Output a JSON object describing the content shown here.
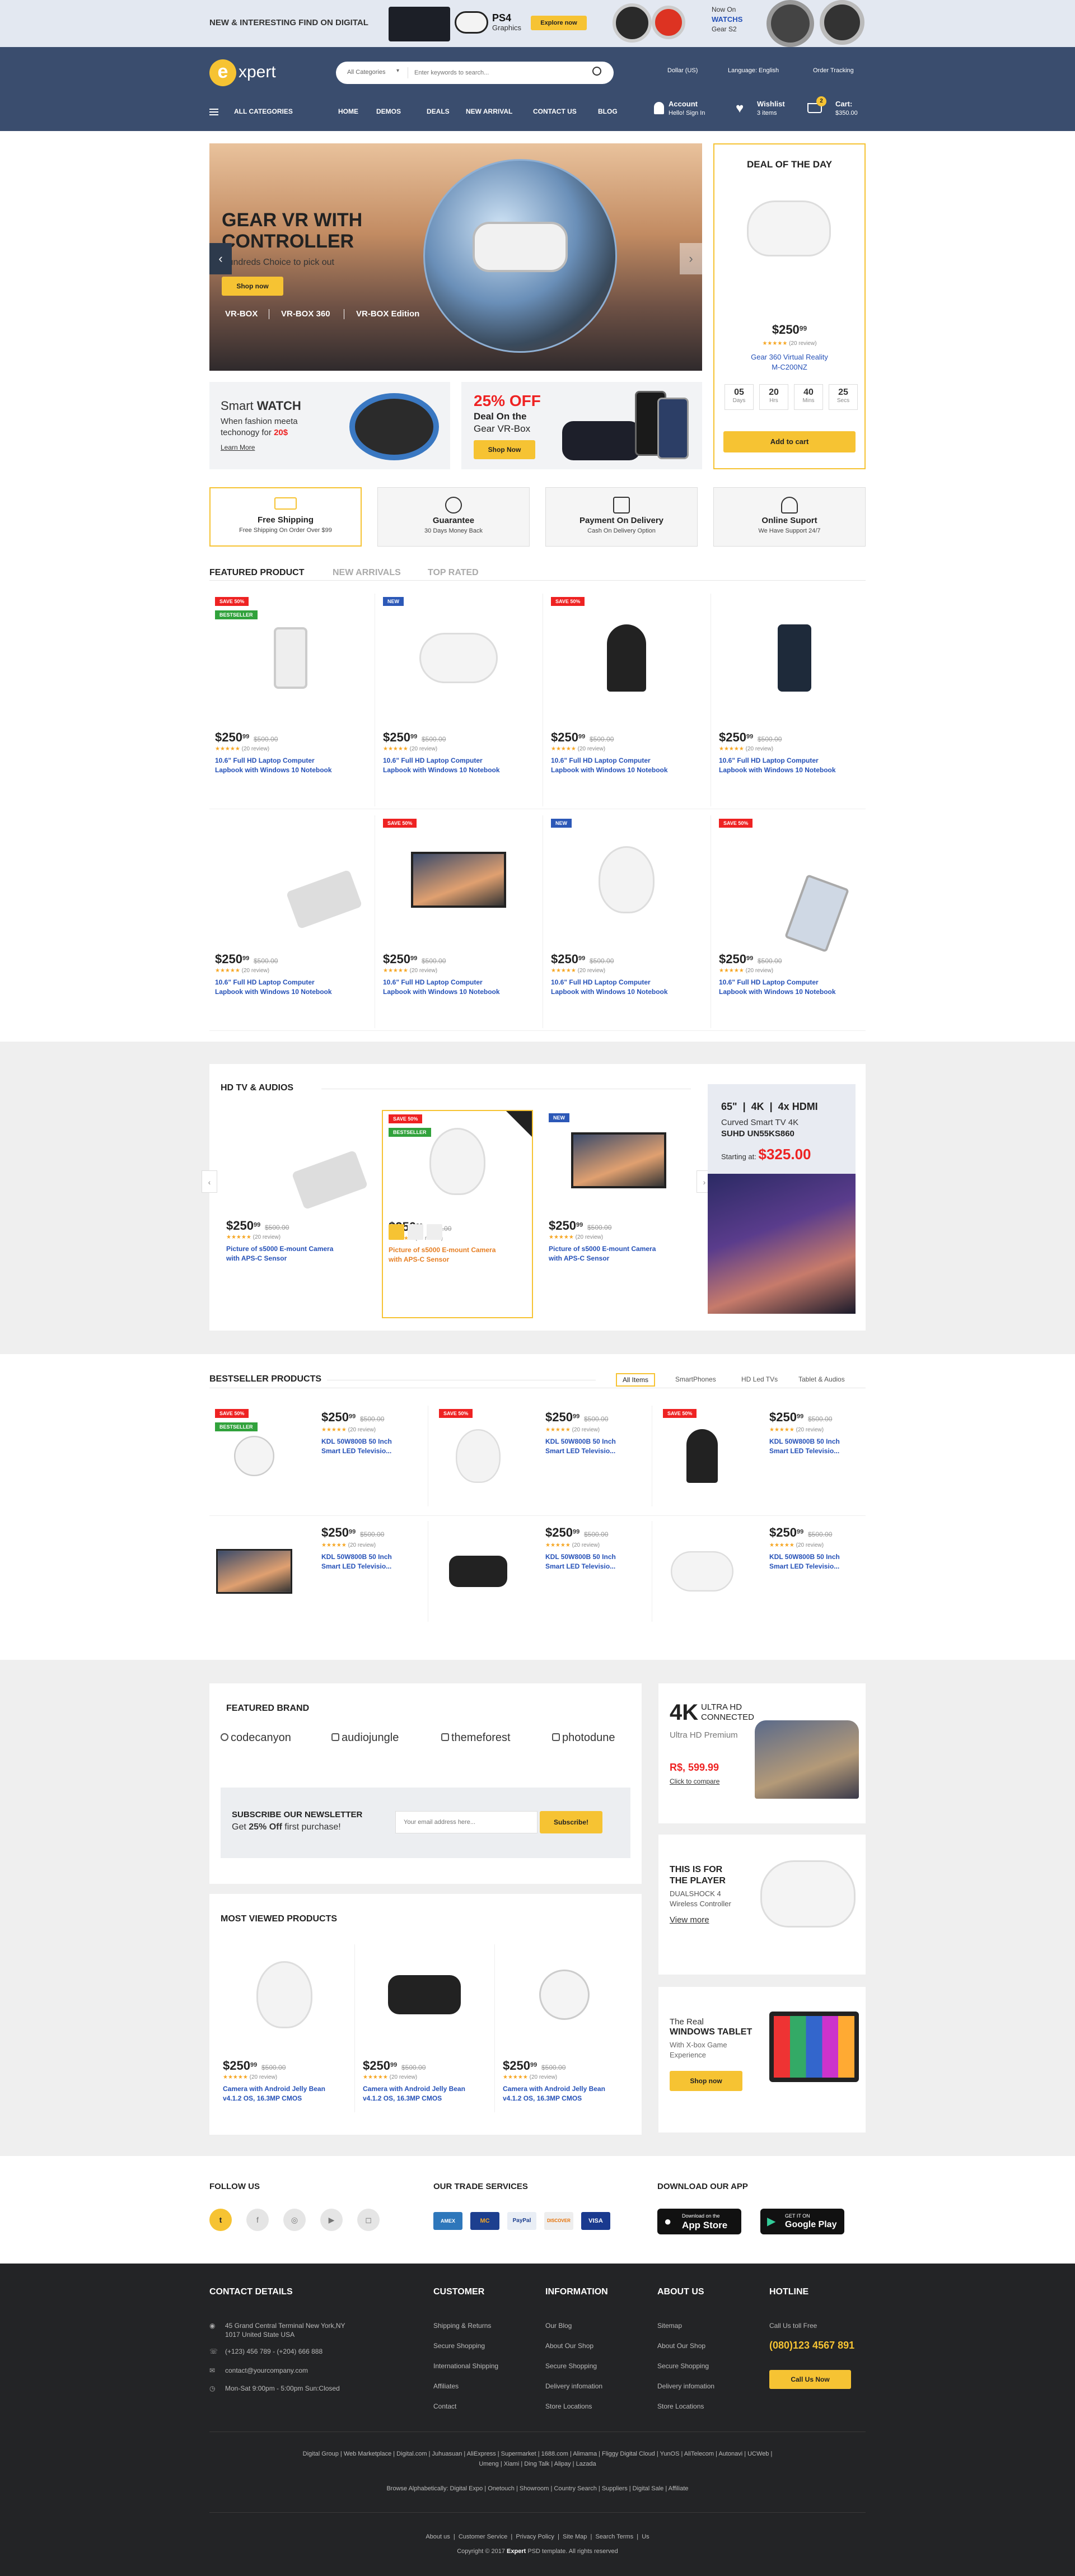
{
  "topbanner": {
    "tagline": "NEW & INTERESTING FIND ON DIGITAL",
    "ps4": "PS4",
    "ps4_sub": "Graphics",
    "explore": "Explore now",
    "nowon": "Now On",
    "watchs": "WATCHS",
    "gear": "Gear S2"
  },
  "header": {
    "logo_e": "e",
    "logo_rest": "xpert",
    "category": "All Categories",
    "search_placeholder": "Enter keywords to search...",
    "currency": "Dollar (US)",
    "language": "Language: English",
    "order": "Order Tracking",
    "nav": [
      "ALL CATEGORIES",
      "HOME",
      "DEMOS",
      "DEALS",
      "NEW ARRIVAL",
      "CONTACT US",
      "BLOG"
    ],
    "account": "Account",
    "account_sub": "Hello! Sign In",
    "wishlist": "Wishlist",
    "wishlist_sub": "3 items",
    "cart": "Cart:",
    "cart_total": "$350.00",
    "cart_count": "2"
  },
  "hero": {
    "title1": "GEAR VR WITH",
    "title2": "CONTROLLER",
    "sub": "Hundreds Choice to pick out",
    "cta": "Shop now",
    "links": [
      "VR-BOX",
      "VR-BOX 360",
      "VR-BOX Edition"
    ]
  },
  "deal": {
    "title": "DEAL OF THE DAY",
    "price": "$250",
    "cents": "99",
    "reviews": "(20 review)",
    "name1": "Gear 360 Virtual Reality",
    "name2": "M-C200NZ",
    "countdown": [
      {
        "n": "05",
        "u": "Days"
      },
      {
        "n": "20",
        "u": "Hrs"
      },
      {
        "n": "40",
        "u": "Mins"
      },
      {
        "n": "25",
        "u": "Secs"
      }
    ],
    "cta": "Add to cart"
  },
  "promo1": {
    "title_a": "Smart ",
    "title_b": "WATCH",
    "line1": "When fashion meeta",
    "line2": "techonogy for ",
    "price": "20$",
    "link": "Learn More"
  },
  "promo2": {
    "pct": "25% OFF",
    "l1": "Deal On the",
    "l2": "Gear VR-Box",
    "cta": "Shop Now"
  },
  "features": [
    {
      "t": "Free Shipping",
      "s": "Free Shipping On Order Over $99",
      "icon": "truck-icon"
    },
    {
      "t": "Guarantee",
      "s": "30 Days Money Back",
      "icon": "money-icon"
    },
    {
      "t": "Payment On Delivery",
      "s": "Cash On Delivery Option",
      "icon": "payment-icon"
    },
    {
      "t": "Online Suport",
      "s": "We Have Support 24/7",
      "icon": "support-icon"
    }
  ],
  "featured": {
    "tabs": [
      "FEATURED PRODUCT",
      "NEW ARRIVALS",
      "TOP RATED"
    ],
    "price": "$250",
    "cents": "99",
    "old": "$500.00",
    "reviews": "(20 review)",
    "name1": "10.6\" Full HD Laptop Computer",
    "name2": "Lapbook with Windows 10 Notebook",
    "tags": {
      "save": "SAVE 50%",
      "best": "BESTSELLER",
      "new": "NEW"
    }
  },
  "hdtv": {
    "title": "HD TV & AUDIOS",
    "price": "$250",
    "cents": "99",
    "old": "$500.00",
    "reviews": "(20 review)",
    "name1": "Picture of s5000 E-mount Camera",
    "name2": "with APS-C Sensor",
    "ad": {
      "specs": [
        "65\"",
        "4K",
        "4x HDMI"
      ],
      "l1": "Curved Smart TV 4K",
      "l2": "SUHD UN55KS860",
      "start": "Starting at:",
      "price": "$325.00"
    }
  },
  "bestseller": {
    "title": "BESTSELLER PRODUCTS",
    "filters": [
      "All Items",
      "SmartPhones",
      "HD Led TVs",
      "Tablet & Audios"
    ],
    "price": "$250",
    "cents": "99",
    "old": "$500.00",
    "reviews": "(20 review)",
    "name1": "KDL 50W800B 50 Inch",
    "name2": "Smart LED Televisio..."
  },
  "brand": {
    "title": "FEATURED BRAND",
    "brands": [
      "codecanyon",
      "audiojungle",
      "themeforest",
      "photodune"
    ],
    "newsletter_t": "SUBSCRIBE OUR NEWSLETTER",
    "newsletter_a": "Get ",
    "newsletter_b": "25% Off",
    "newsletter_c": " first purchase!",
    "email_ph": "Your email address here...",
    "subscribe": "Subscribe!"
  },
  "ad4k": {
    "big": "4K",
    "ultra": "ULTRA HD",
    "connected": "CONNECTED",
    "premium": "Ultra HD Premium",
    "price": "R$, 599.99",
    "link": "Click to compare"
  },
  "adplayer": {
    "l1": "THIS IS FOR",
    "l2": "THE PLAYER",
    "l3": "DUALSHOCK 4",
    "l4": "Wireless Controller",
    "link": "View more"
  },
  "adtablet": {
    "l1": "The Real",
    "l2": "WINDOWS TABLET",
    "l3": "With X-box Game",
    "l4": "Experience",
    "cta": "Shop now"
  },
  "mostviewed": {
    "title": "MOST VIEWED PRODUCTS",
    "price": "$250",
    "cents": "99",
    "old": "$500.00",
    "reviews": "(20 review)",
    "name1": "Camera with Android Jelly Bean",
    "name2": "v4.1.2 OS, 16.3MP CMOS"
  },
  "social": {
    "follow": "FOLLOW US",
    "trade": "OUR TRADE SERVICES",
    "app": "DOWNLOAD OUR APP",
    "cards": [
      "AMEX",
      "MC",
      "PayPal",
      "DISCOVER",
      "VISA"
    ],
    "appstore_s": "Download on the",
    "appstore": "App Store",
    "gplay_s": "GET IT ON",
    "gplay": "Google Play"
  },
  "footer": {
    "contact": "CONTACT DETAILS",
    "addr1": "45 Grand Central Terminal New York,NY",
    "addr2": "1017 United State USA",
    "phone": "(+123) 456 789 - (+204) 666 888",
    "email": "contact@yourcompany.com",
    "hours": "Mon-Sat 9:00pm - 5:00pm Sun:Closed",
    "customer": "CUSTOMER",
    "customer_links": [
      "Shipping & Returns",
      "Secure Shopping",
      "International Shipping",
      "Affiliates",
      "Contact"
    ],
    "information": "INFORMATION",
    "info_links": [
      "Our Blog",
      "About Our Shop",
      "Secure Shopping",
      "Delivery infomation",
      "Store Locations"
    ],
    "about": "ABOUT US",
    "about_links": [
      "Sitemap",
      "About Our Shop",
      "Secure Shopping",
      "Delivery infomation",
      "Store Locations"
    ],
    "hotline": "HOTLINE",
    "callus": "Call Us toll Free",
    "hotnum": "(080)123 4567 891",
    "callbtn": "Call Us Now",
    "links1": "Digital Group  |  Web Marketplace  |  Digital.com  |  Juhuasuan  |  AliExpress  |  Supermarket  |  1688.com  |  Alimama  |  Fliggy Digital Cloud  |  YunOS  |  AliTelecom  |  Autonavi  |  UCWeb  |",
    "links1b": "Umeng  |  Xiami  |  Ding Talk  |  Alipay  |  Lazada",
    "links2": "Browse Alphabetically: Digital Expo  |  Onetouch  |  Showroom  |  Country Search  |  Suppliers  |  Digital Sale  |  Affiliate",
    "bottom": [
      "About us",
      "Customer Service",
      "Privacy Policy",
      "Site Map",
      "Search Terms",
      "Us"
    ],
    "copy_a": "Copyright © 2017 ",
    "copy_b": "Expert",
    "copy_c": " PSD template. All rights reserved"
  }
}
